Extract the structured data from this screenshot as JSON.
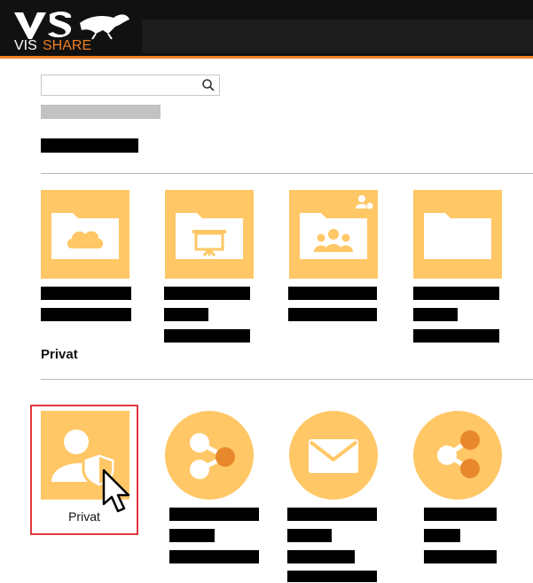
{
  "brand": {
    "logo_text_a": "VIS",
    "logo_text_b": "SHARE",
    "logo_mark": "VS",
    "accent": "#f07f23"
  },
  "search": {
    "placeholder": "",
    "value": ""
  },
  "folders": [
    {
      "icon": "cloud-folder-icon"
    },
    {
      "icon": "presentation-folder-icon"
    },
    {
      "icon": "group-folder-icon",
      "badge": "shared-user-badge-icon"
    },
    {
      "icon": "folder-icon"
    }
  ],
  "section": {
    "title": "Privat"
  },
  "private_items": [
    {
      "icon": "user-shield-icon",
      "label": "Privat"
    },
    {
      "icon": "share-icon"
    },
    {
      "icon": "envelope-icon"
    },
    {
      "icon": "share-alt-icon"
    }
  ],
  "colors": {
    "tile": "#ffc766",
    "icon_fill": "#ffffff",
    "dot": "#e8882c",
    "highlight": "#e0393e"
  }
}
